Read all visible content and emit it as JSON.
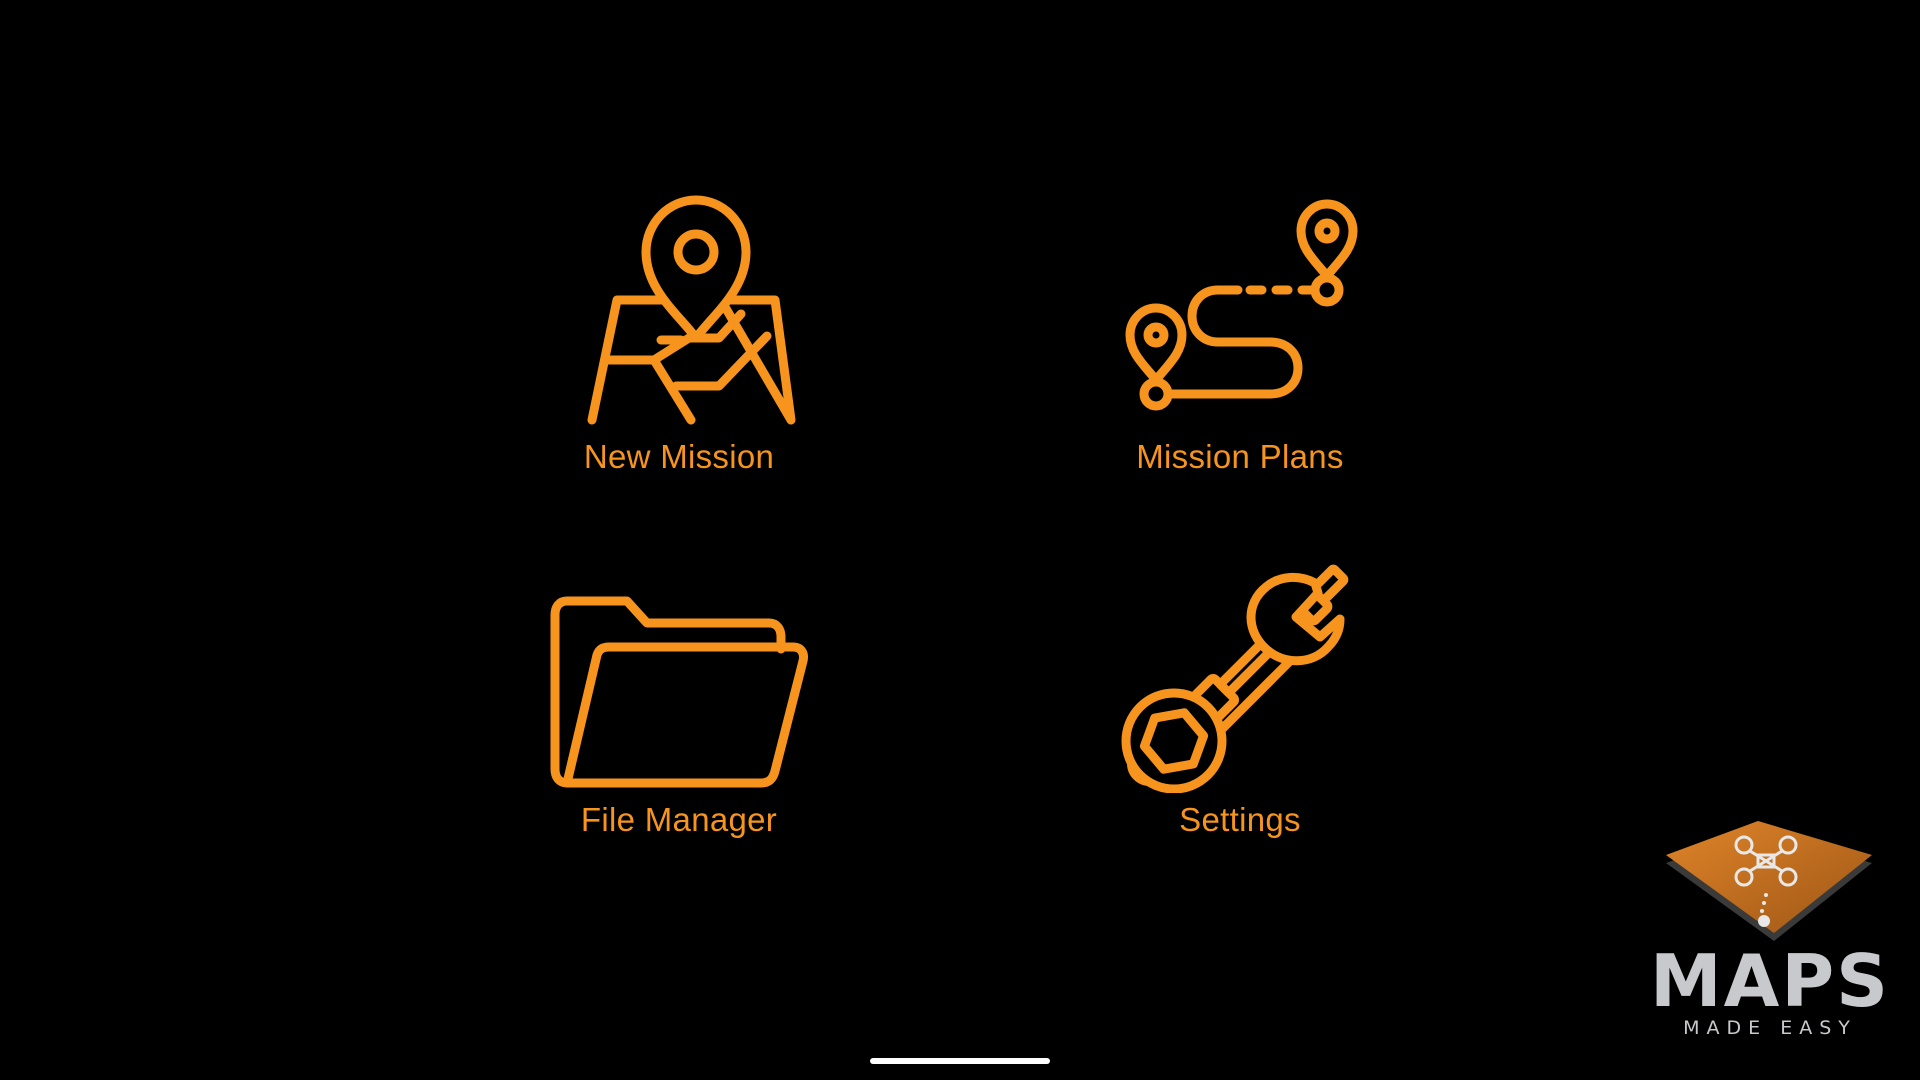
{
  "menu": {
    "tiles": [
      {
        "label": "New Mission",
        "icon": "map-pin-icon"
      },
      {
        "label": "Mission Plans",
        "icon": "route-icon"
      },
      {
        "label": "File Manager",
        "icon": "folder-icon"
      },
      {
        "label": "Settings",
        "icon": "tools-icon"
      }
    ]
  },
  "brand": {
    "wordmark": "MAPS",
    "tagline": "MADE EASY",
    "logo_icon": "drone-map-logo-icon"
  },
  "colors": {
    "background": "#000000",
    "accent": "#f7941d",
    "brand_gray": "#c8c9cc",
    "logo_orange": "#b86a1a"
  }
}
